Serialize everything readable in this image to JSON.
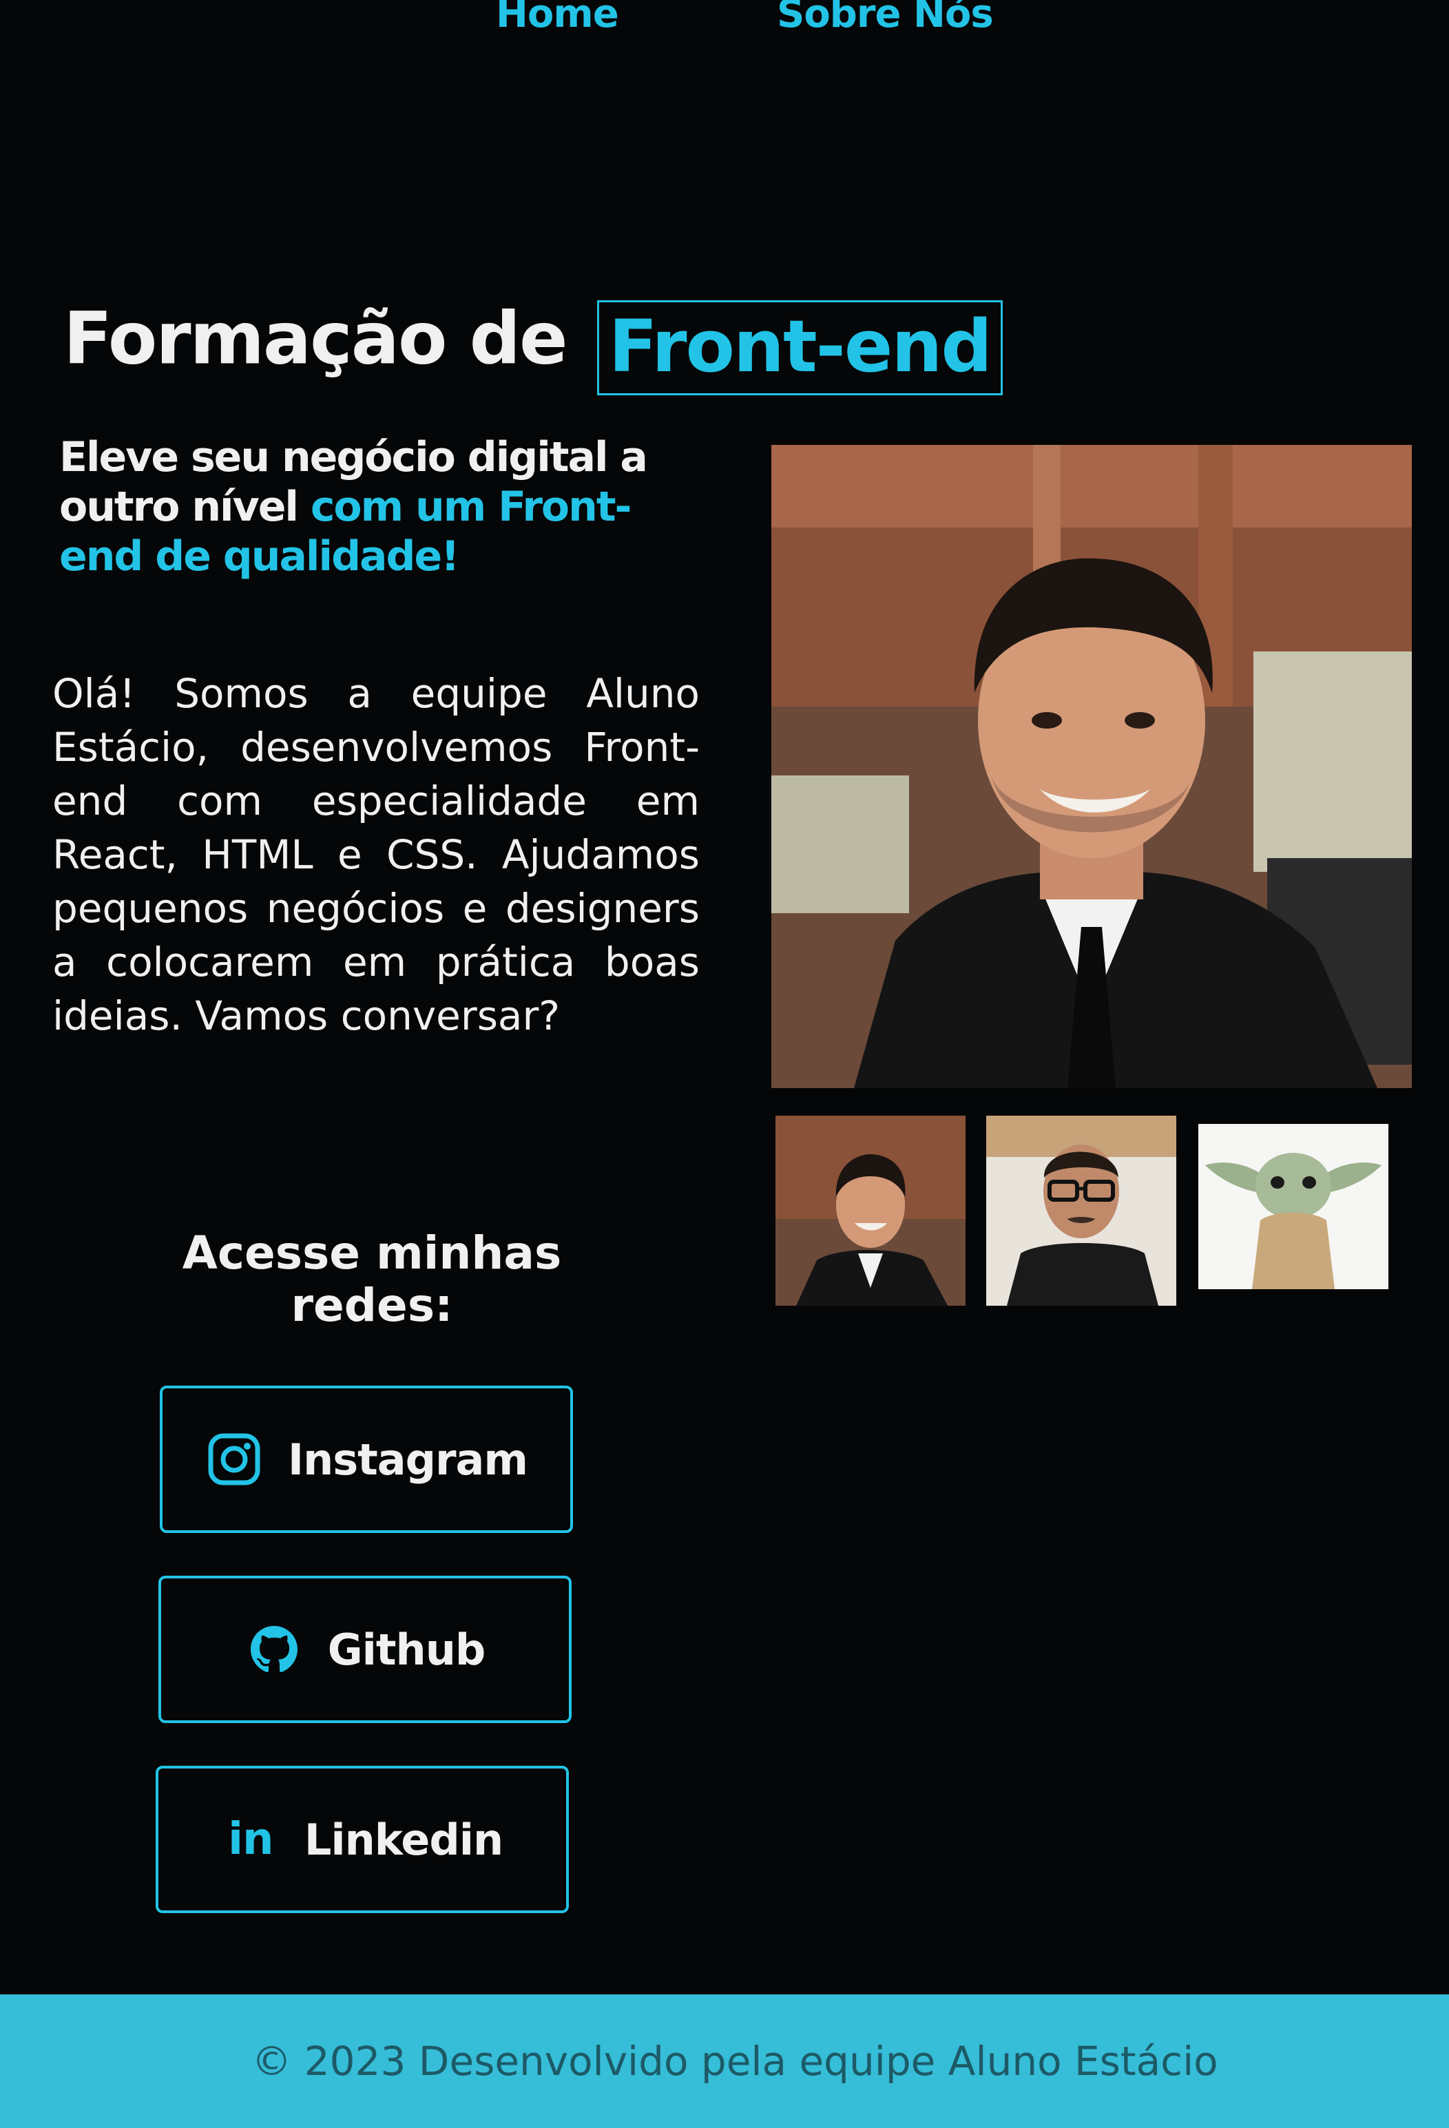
{
  "nav": {
    "home": "Home",
    "sobre": "Sobre Nós"
  },
  "hero": {
    "title_prefix": "Formação de",
    "title_highlight": "Front-end",
    "subtitle_main": "Eleve seu negócio digital a outro nível ",
    "subtitle_highlight": "com um Front-end de qualidade!",
    "paragraph": "Olá! Somos a equipe Aluno Estácio, desenvolvemos Front-end com especialidade em React, HTML e CSS. Ajudamos pequenos negócios e designers a colocarem em prática boas ideias. Vamos conversar?"
  },
  "social": {
    "heading": "Acesse minhas redes:",
    "buttons": [
      {
        "label": "Instagram",
        "icon": "instagram-icon"
      },
      {
        "label": "Github",
        "icon": "github-icon"
      },
      {
        "label": "Linkedin",
        "icon": "linkedin-icon"
      }
    ]
  },
  "gallery": {
    "main": "portrait-photo",
    "thumbs": [
      "portrait-thumb",
      "glasses-man-thumb",
      "baby-yoda-thumb"
    ]
  },
  "footer": {
    "text": "© 2023 Desenvolvido pela equipe Aluno Estácio"
  },
  "colors": {
    "accent": "#22c3e6",
    "background": "#050607",
    "footer": "#36bdd8"
  }
}
